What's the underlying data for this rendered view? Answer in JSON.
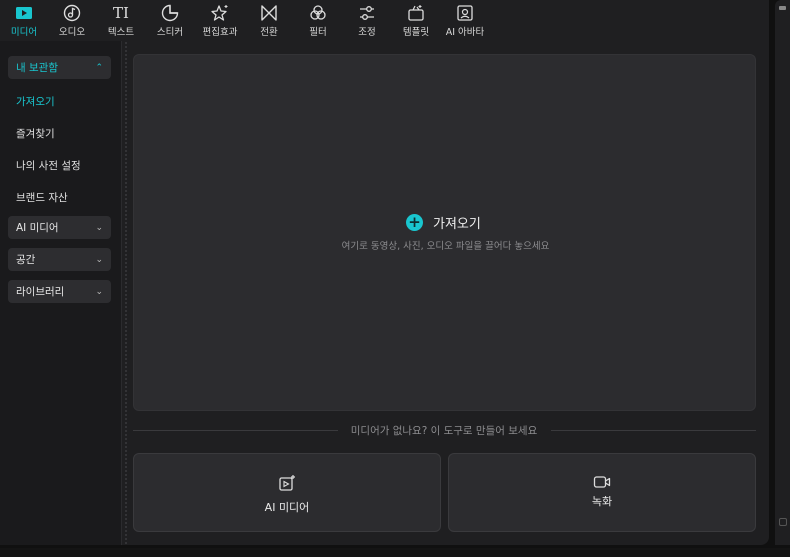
{
  "toolbar": {
    "items": [
      {
        "label": "미디어",
        "icon": "media-play-icon",
        "active": true
      },
      {
        "label": "오디오",
        "icon": "audio-note-icon"
      },
      {
        "label": "텍스트",
        "icon": "text-ti-icon",
        "glyph": "TI"
      },
      {
        "label": "스티커",
        "icon": "sticker-icon"
      },
      {
        "label": "편집효과",
        "icon": "effects-star-icon"
      },
      {
        "label": "전환",
        "icon": "transition-bowtie-icon"
      },
      {
        "label": "필터",
        "icon": "filter-circles-icon"
      },
      {
        "label": "조정",
        "icon": "adjust-sliders-icon"
      },
      {
        "label": "템플릿",
        "icon": "template-icon"
      },
      {
        "label": "AI 아바타",
        "icon": "ai-avatar-icon"
      }
    ]
  },
  "sidebar": {
    "my_library": "내 보관함",
    "import": "가져오기",
    "favorites": "즐겨찾기",
    "my_preset": "나의 사전 설정",
    "brand_assets": "브랜드 자산",
    "ai_media": "AI 미디어",
    "space": "공간",
    "libraries": "라이브러리"
  },
  "main": {
    "import_label": "가져오기",
    "import_hint": "여기로 동영상, 사진, 오디오 파일을 끌어다 놓으세요",
    "no_media_text": "미디어가 없나요? 이 도구로 만들어 보세요",
    "card_ai_media": "AI 미디어",
    "card_record": "녹화"
  },
  "colors": {
    "accent": "#19c6cf",
    "panel": "#1f1f21",
    "surface": "#2c2c2f"
  }
}
